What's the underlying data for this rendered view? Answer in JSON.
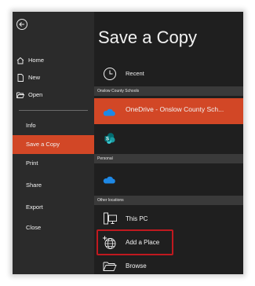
{
  "sidebar": {
    "items": [
      {
        "id": "home",
        "label": "Home"
      },
      {
        "id": "new",
        "label": "New"
      },
      {
        "id": "open",
        "label": "Open"
      },
      {
        "id": "info",
        "label": "Info"
      },
      {
        "id": "save-a-copy",
        "label": "Save a Copy",
        "active": true
      },
      {
        "id": "print",
        "label": "Print"
      },
      {
        "id": "share",
        "label": "Share"
      },
      {
        "id": "export",
        "label": "Export"
      },
      {
        "id": "close",
        "label": "Close"
      }
    ]
  },
  "main": {
    "title": "Save a Copy",
    "recent_label": "Recent",
    "sections": {
      "org": "Onslow County Schools",
      "personal": "Personal",
      "other": "Other locations"
    },
    "onedrive_org_label": "OneDrive - Onslow County Sch...",
    "this_pc_label": "This PC",
    "add_place_label": "Add a Place",
    "browse_label": "Browse"
  },
  "colors": {
    "accent": "#d24726",
    "background": "#1f1f1f",
    "sidebar": "#2b2b2b",
    "highlight_border": "#c0191f",
    "onedrive_blue": "#1e88e5",
    "sharepoint_teal": "#038387"
  }
}
